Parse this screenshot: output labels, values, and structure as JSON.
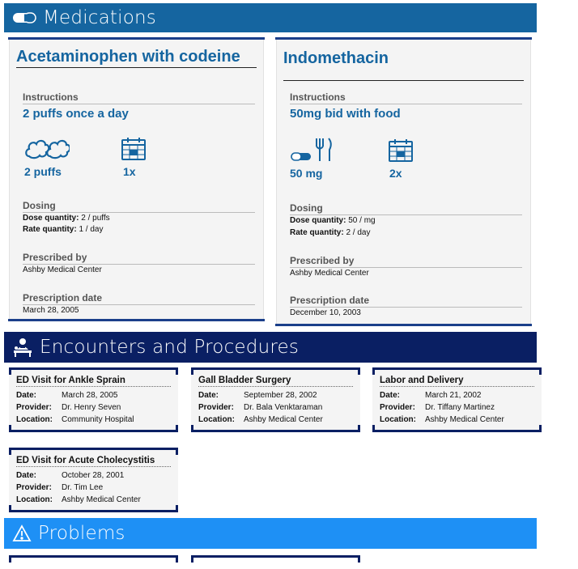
{
  "sections": {
    "medications": {
      "title": "Medications",
      "icon": "pill-icon"
    },
    "encounters": {
      "title": "Encounters and Procedures",
      "icon": "doctor-patient-icon"
    },
    "problems": {
      "title": "Problems",
      "icon": "warning-triangle-icon"
    }
  },
  "medications": [
    {
      "name": "Acetaminophen with codeine",
      "instructions_label": "Instructions",
      "instructions": "2 puffs once a day",
      "dose_display": "2 puffs",
      "dose_icon": "puff-cloud-icon",
      "frequency_display": "1x",
      "frequency_icon": "calendar-icon",
      "dosing_label": "Dosing",
      "dose_quantity_label": "Dose quantity:",
      "dose_quantity": "2 / puffs",
      "rate_quantity_label": "Rate quantity:",
      "rate_quantity": "1 / day",
      "prescribed_by_label": "Prescribed by",
      "prescribed_by": "Ashby Medical Center",
      "prescription_date_label": "Prescription date",
      "prescription_date": "March 28, 2005"
    },
    {
      "name": "Indomethacin",
      "instructions_label": "Instructions",
      "instructions": "50mg bid with food",
      "dose_display": "50 mg",
      "dose_icon": "pill-with-food-icon",
      "frequency_display": "2x",
      "frequency_icon": "calendar-icon",
      "dosing_label": "Dosing",
      "dose_quantity_label": "Dose quantity:",
      "dose_quantity": "50 / mg",
      "rate_quantity_label": "Rate quantity:",
      "rate_quantity": "2 / day",
      "prescribed_by_label": "Prescribed by",
      "prescribed_by": "Ashby Medical Center",
      "prescription_date_label": "Prescription date",
      "prescription_date": "December 10, 2003"
    }
  ],
  "encounter_labels": {
    "date": "Date:",
    "provider": "Provider:",
    "location": "Location:"
  },
  "encounters": [
    {
      "title": "ED Visit for Ankle Sprain",
      "date": "March 28, 2005",
      "provider": "Dr. Henry Seven",
      "location": "Community Hospital"
    },
    {
      "title": "Gall Bladder Surgery",
      "date": "September 28, 2002",
      "provider": "Dr. Bala Venktaraman",
      "location": "Ashby Medical Center"
    },
    {
      "title": "Labor and Delivery",
      "date": "March 21, 2002",
      "provider": "Dr. Tiffany Martinez",
      "location": "Ashby Medical Center"
    },
    {
      "title": "ED Visit for Acute Cholecystitis",
      "date": "October 28, 2001",
      "provider": "Dr. Tim Lee",
      "location": "Ashby Medical Center"
    }
  ],
  "colors": {
    "medications_header": "#1565a0",
    "encounters_header": "#0a1f63",
    "problems_header": "#1e90f5",
    "accent_text": "#1565a0"
  }
}
